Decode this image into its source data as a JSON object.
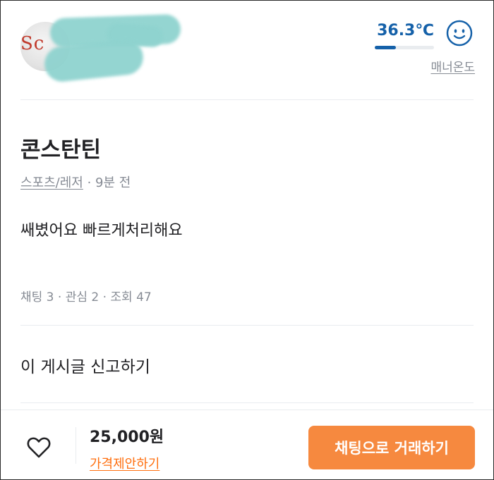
{
  "seller": {
    "avatar_logo_text": "Sc",
    "manner_temperature": "36.3℃",
    "manner_temperature_value": 36.3,
    "manner_bar_fraction": 0.363,
    "manner_label": "매너온도",
    "temperature_color": "#1561a9",
    "face_icon": "smiley-face-icon"
  },
  "article": {
    "title": "콘스탄틴",
    "category": "스포츠/레저",
    "time_ago": "· 9분 전",
    "description": "쌔볐어요 빠르게처리해요",
    "stats": "채팅 3 · 관심 2 · 조회 47",
    "report_label": "이 게시글 신고하기"
  },
  "bottom_bar": {
    "heart_icon": "heart-outline-icon",
    "price": "25,000원",
    "offer_label": "가격제안하기",
    "chat_button_label": "채팅으로 거래하기",
    "accent_color": "#ff6f0f",
    "button_color": "#f6893f"
  }
}
